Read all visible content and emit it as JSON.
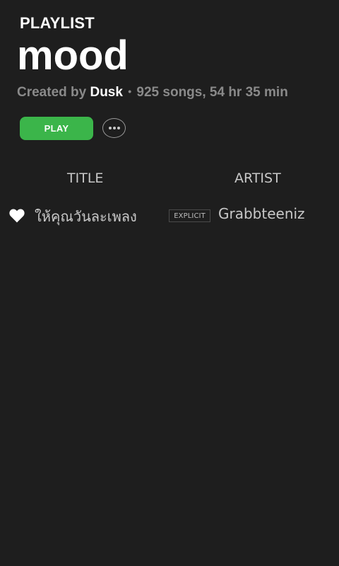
{
  "playlist": {
    "kind": "PLAYLIST",
    "title": "mood",
    "created_by_label": "Created by",
    "owner": "Dusk",
    "separator": "•",
    "stats": "925 songs, 54 hr 35 min"
  },
  "actions": {
    "play_label": "PLAY",
    "more_icon": "more-horizontal-icon"
  },
  "columns": {
    "title": "TITLE",
    "artist": "ARTIST"
  },
  "tracks": [
    {
      "liked_icon": "heart-icon",
      "title": "ให้คุณวันละเพลง",
      "badge": "EXPLICIT",
      "artist": "Grabbteeniz"
    }
  ],
  "colors": {
    "background": "#1e1e1e",
    "accent": "#3bb54a",
    "text_primary": "#ffffff",
    "text_secondary": "#8a8a8a"
  }
}
